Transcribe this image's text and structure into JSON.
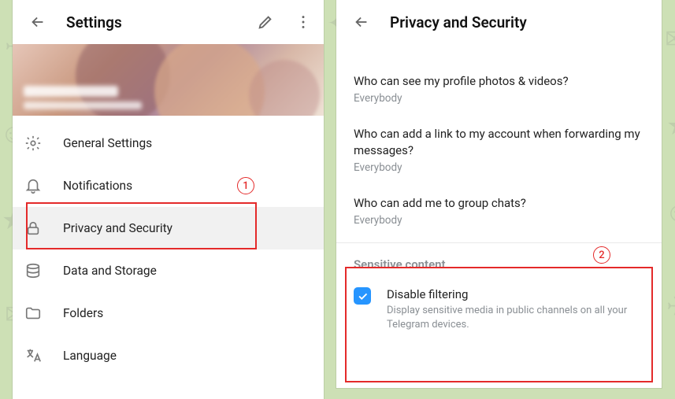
{
  "left": {
    "title": "Settings",
    "menu": [
      {
        "label": "General Settings"
      },
      {
        "label": "Notifications"
      },
      {
        "label": "Privacy and Security"
      },
      {
        "label": "Data and Storage"
      },
      {
        "label": "Folders"
      },
      {
        "label": "Language"
      }
    ]
  },
  "right": {
    "title": "Privacy and Security",
    "rows": [
      {
        "q": "Who can see my profile photos & videos?",
        "v": "Everybody"
      },
      {
        "q": "Who can add a link to my account when forwarding my messages?",
        "v": "Everybody"
      },
      {
        "q": "Who can add me to group chats?",
        "v": "Everybody"
      }
    ],
    "sensitive": {
      "section": "Sensitive content",
      "title": "Disable filtering",
      "desc": "Display sensitive media in public channels on all your Telegram devices."
    }
  },
  "annotations": {
    "one": "1",
    "two": "2"
  }
}
